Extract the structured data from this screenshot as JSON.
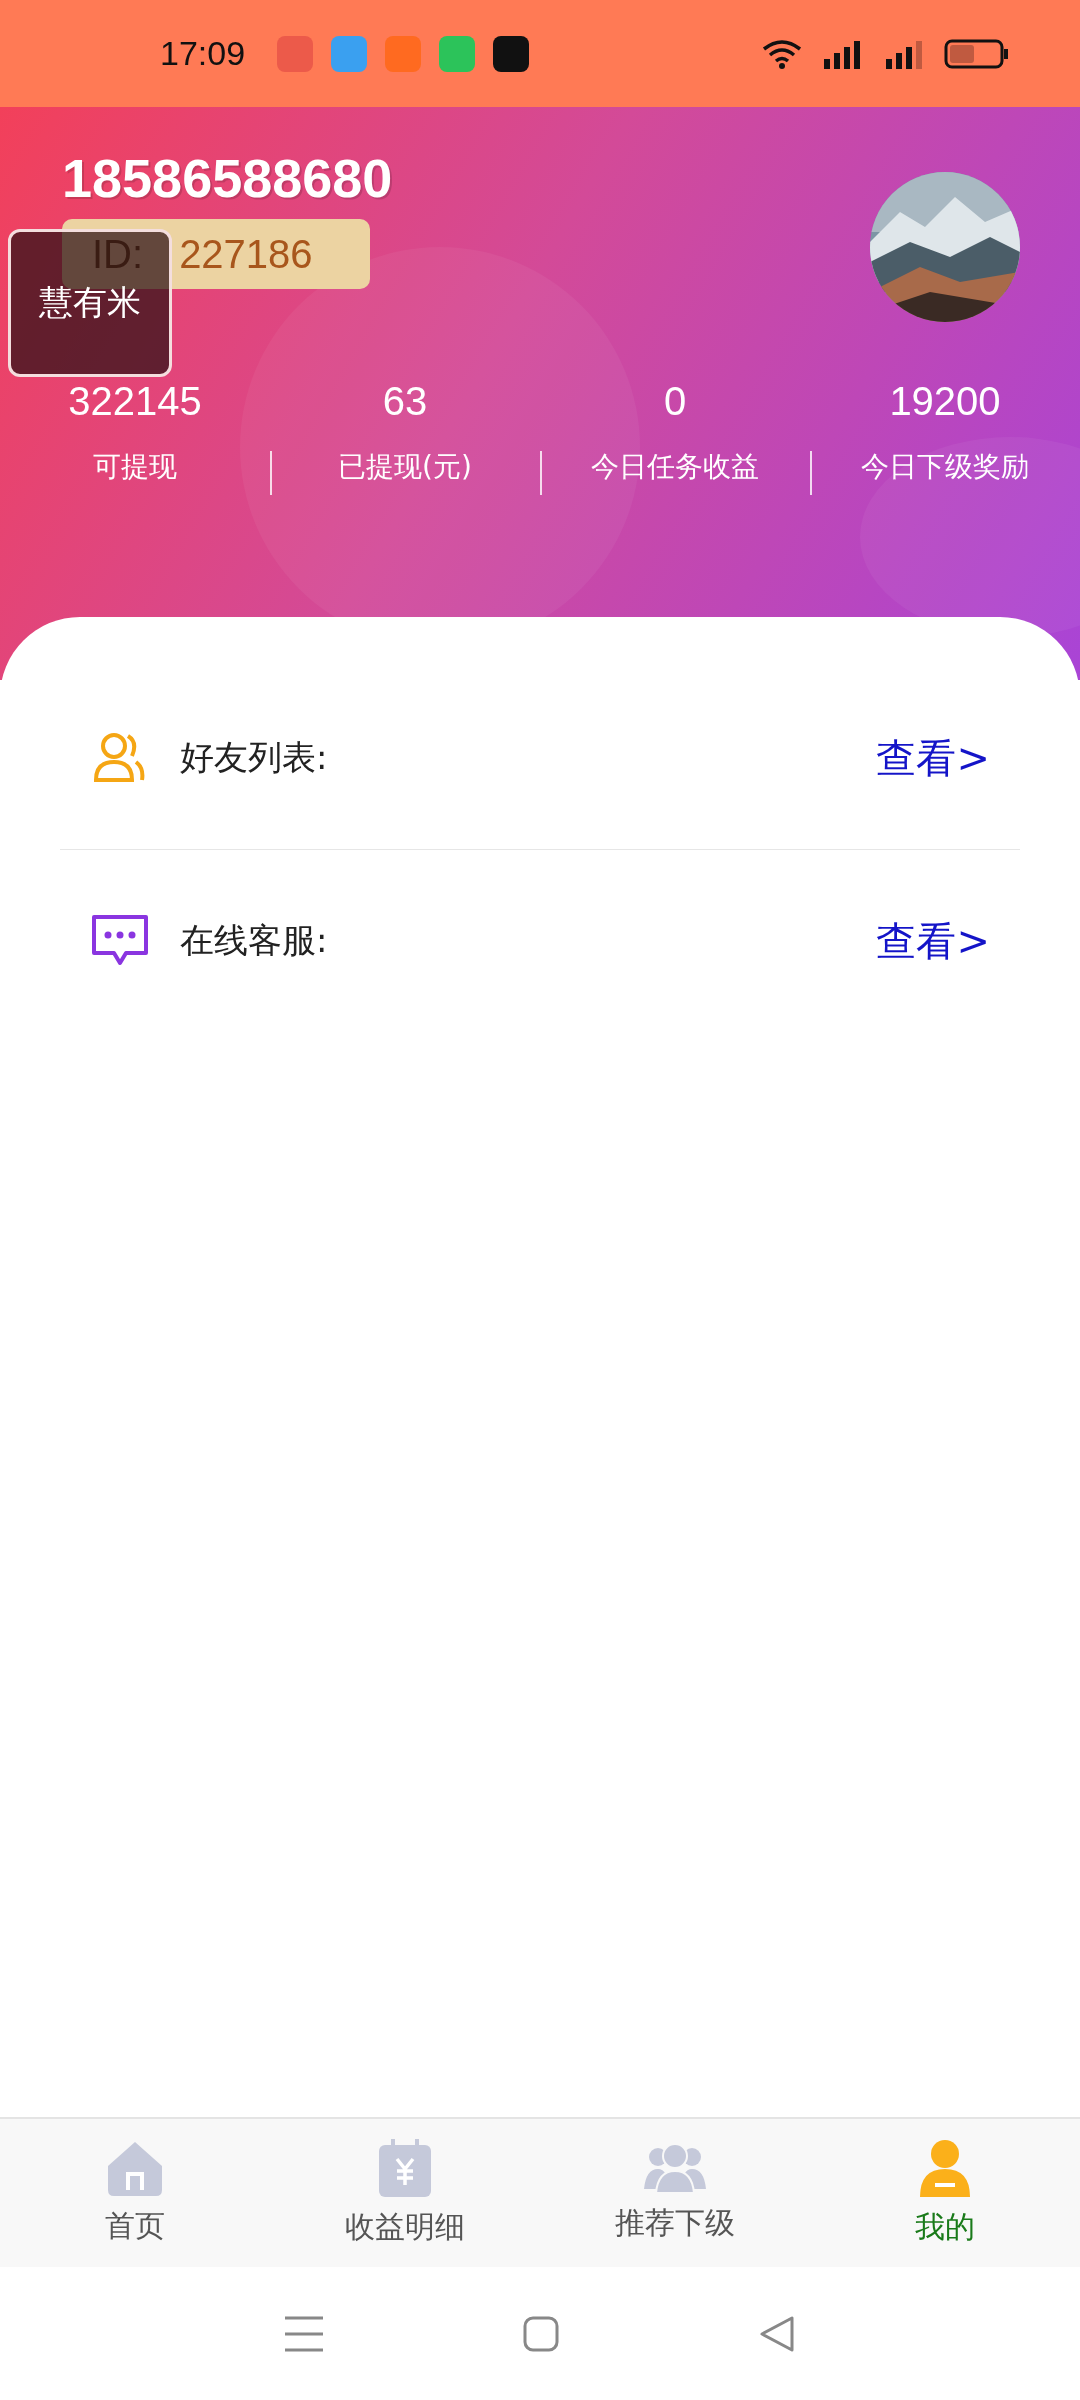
{
  "status_bar": {
    "time": "17:09"
  },
  "profile": {
    "phone": "18586588680",
    "id_label": "ID:",
    "id_value": "227186",
    "overlay_label": "慧有米"
  },
  "stats": [
    {
      "value": "322145",
      "label": "可提现"
    },
    {
      "value": "63",
      "label": "已提现(元)"
    },
    {
      "value": "0",
      "label": "今日任务收益"
    },
    {
      "value": "19200",
      "label": "今日下级奖励"
    }
  ],
  "menu": [
    {
      "kind": "friends",
      "label": "好友列表:",
      "action": "查看>"
    },
    {
      "kind": "service",
      "label": "在线客服:",
      "action": "查看>"
    }
  ],
  "tabs": [
    {
      "kind": "home",
      "label": "首页",
      "selected": false
    },
    {
      "kind": "income",
      "label": "收益明细",
      "selected": false
    },
    {
      "kind": "team",
      "label": "推荐下级",
      "selected": false
    },
    {
      "kind": "me",
      "label": "我的",
      "selected": true
    }
  ]
}
